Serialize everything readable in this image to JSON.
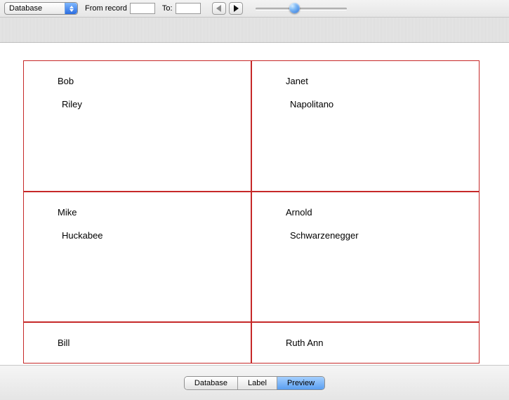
{
  "toolbar": {
    "source_select": {
      "label": "Database"
    },
    "from_record_label": "From record",
    "to_label": "To:",
    "from_value": "",
    "to_value": "",
    "nav": {
      "prev_icon": "triangle-left",
      "next_icon": "triangle-right"
    },
    "zoom": {
      "min": 0,
      "max": 100,
      "value": 40
    }
  },
  "preview": {
    "cards": [
      {
        "first": "Bob",
        "last": "Riley"
      },
      {
        "first": "Janet",
        "last": "Napolitano"
      },
      {
        "first": "Mike",
        "last": "Huckabee"
      },
      {
        "first": "Arnold",
        "last": "Schwarzenegger"
      },
      {
        "first": "Bill",
        "last": ""
      },
      {
        "first": "Ruth Ann",
        "last": ""
      }
    ]
  },
  "tabs": {
    "items": [
      "Database",
      "Label",
      "Preview"
    ],
    "active_index": 2
  },
  "colors": {
    "border_red": "#c62828",
    "aqua_blue": "#3a80e8"
  }
}
